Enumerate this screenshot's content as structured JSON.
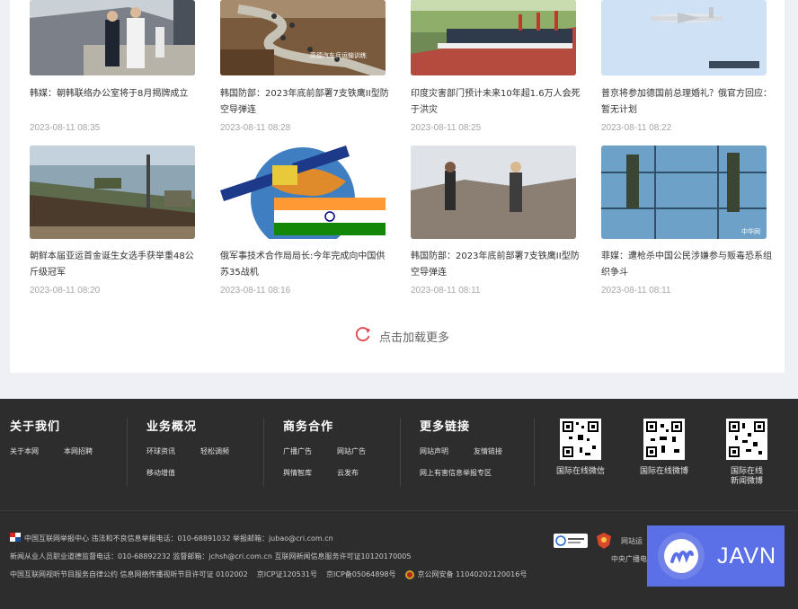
{
  "news": [
    {
      "title": "韩媒：朝韩联络办公室将于8月揭牌成立",
      "time": "2023-08-11 08:35",
      "image": "navy-officers-photo"
    },
    {
      "title": "韩国防部：2023年底前部署7支铁鹰II型防空导弹连",
      "time": "2023-08-11 08:28",
      "image": "convoy-road-photo",
      "image_caption": "高德汽车兵运输训练"
    },
    {
      "title": "印度灾害部门预计未来10年超1.6万人会死于洪灾",
      "time": "2023-08-11 08:25",
      "image": "military-parade-photo"
    },
    {
      "title": "普京将参加德国前总理婚礼？俄官方回应：暂无计划",
      "time": "2023-08-11 08:22",
      "image": "aircraft-sky-photo"
    },
    {
      "title": "朝鲜本届亚运首金诞生女选手获举重48公斤级冠军",
      "time": "2023-08-11 08:20",
      "image": "pontoon-bridge-photo"
    },
    {
      "title": "俄军事技术合作局局长:今年完成向中国供苏35战机",
      "time": "2023-08-11 08:16",
      "image": "satellite-india-flag-graphic"
    },
    {
      "title": "韩国防部：2023年底前部署7支铁鹰II型防空导弹连",
      "time": "2023-08-11 08:11",
      "image": "desert-soldiers-photo"
    },
    {
      "title": "菲媒：遭枪杀中国公民涉嫌参与贩毒恐系组织争斗",
      "time": "2023-08-11 08:11",
      "image": "soldiers-glass-photo",
      "image_caption": "中华网"
    }
  ],
  "load_more": {
    "label": "点击加载更多",
    "icon": "refresh-icon"
  },
  "footer": {
    "about": {
      "title": "关于我们",
      "links": [
        "关于本网",
        "本网招聘"
      ]
    },
    "business": {
      "title": "业务概况",
      "links": [
        "环球资讯",
        "轻松调频",
        "移动增值"
      ]
    },
    "commerce": {
      "title": "商务合作",
      "links": [
        "广播广告",
        "网站广告",
        "舆情智库",
        "云发布"
      ]
    },
    "more": {
      "title": "更多链接",
      "links": [
        "网站声明",
        "友情链接",
        "网上有害信息举报专区"
      ]
    },
    "qr_codes": [
      {
        "label": "国际在线微信"
      },
      {
        "label": "国际在线微博"
      },
      {
        "label_line1": "国际在线",
        "label_line2": "新闻微博"
      }
    ],
    "bottom": {
      "line1": "中国互联网举报中心 违法和不良信息举报电话：010-68891032 举报邮箱：jubao@cri.com.cn",
      "line2": "新闻从业人员职业道德监督电话：010-68892232 监督邮箱：jchsh@cri.com.cn  互联网新闻信息服务许可证10120170005",
      "line3_a": "中国互联网视听节目服务自律公约 信息网络传播视听节目许可证 0102002",
      "line3_b": "京ICP证120531号",
      "line3_c": "京ICP备05064898号",
      "line3_d": "京公网安备 11040202120016号",
      "badge_label": "网站运",
      "right_line": "中央广播电"
    }
  },
  "watermark": {
    "text": "JAVN"
  },
  "colors": {
    "accent": "#e1474e",
    "footer_bg": "#2d2d2d",
    "watermark_bg": "#5b6fe6"
  }
}
